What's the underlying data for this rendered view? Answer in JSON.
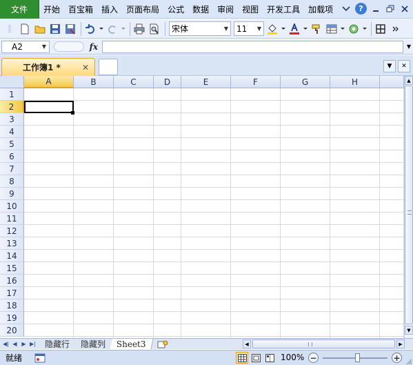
{
  "menubar": {
    "file": "文件",
    "items": [
      "开始",
      "百宝箱",
      "插入",
      "页面布局",
      "公式",
      "数据",
      "审阅",
      "视图",
      "开发工具",
      "加载项"
    ],
    "help_label": "?"
  },
  "toolbar": {
    "font_name": "宋体",
    "font_size": "11",
    "colors": {
      "fill": "#ffd700",
      "font": "#e02020"
    }
  },
  "formula_bar": {
    "name_box": "A2",
    "fx": "fx",
    "formula": ""
  },
  "doc_tabs": {
    "active": "工作簿1 *"
  },
  "grid": {
    "columns": [
      "A",
      "B",
      "C",
      "D",
      "E",
      "F",
      "G",
      "H"
    ],
    "rows": [
      "1",
      "2",
      "3",
      "4",
      "5",
      "6",
      "7",
      "8",
      "9",
      "10",
      "11",
      "12",
      "13",
      "14",
      "15",
      "16",
      "17",
      "18",
      "19",
      "20"
    ],
    "selected_cell": "A2"
  },
  "sheet_tabs": [
    "隐藏行",
    "隐藏列",
    "Sheet3"
  ],
  "active_sheet": "Sheet3",
  "status": {
    "text": "就绪",
    "zoom": "100%"
  }
}
